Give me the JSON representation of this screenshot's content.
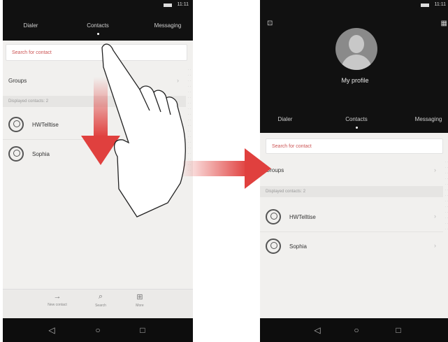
{
  "left_screen": {
    "status_time": "11:11",
    "tabs": [
      {
        "label": "Dialer"
      },
      {
        "label": "Contacts"
      },
      {
        "label": "Messaging"
      }
    ],
    "search_placeholder": "Search for contact",
    "groups_label": "Groups",
    "section_label": "Displayed contacts: 2",
    "contacts": [
      {
        "name": "HWTelltise"
      },
      {
        "name": "Sophia"
      }
    ],
    "bottom_actions": [
      {
        "label": "New contact",
        "icon": "plus-icon"
      },
      {
        "label": "Search",
        "icon": "search-icon"
      },
      {
        "label": "More",
        "icon": "menu-icon"
      }
    ]
  },
  "right_screen": {
    "status_time": "11:11",
    "profile_name": "My profile",
    "tabs": [
      {
        "label": "Dialer"
      },
      {
        "label": "Contacts"
      },
      {
        "label": "Messaging"
      }
    ],
    "search_placeholder": "Search for contact",
    "groups_label": "Groups",
    "section_label": "Displayed contacts: 2",
    "contacts": [
      {
        "name": "HWTelltise"
      },
      {
        "name": "Sophia"
      }
    ]
  },
  "navigation": {
    "back": "◁",
    "home": "○",
    "recent": "□"
  },
  "colors": {
    "arrow_red": "#e0403e",
    "dark_bar": "#111111",
    "list_bg": "#f1f0ee"
  }
}
